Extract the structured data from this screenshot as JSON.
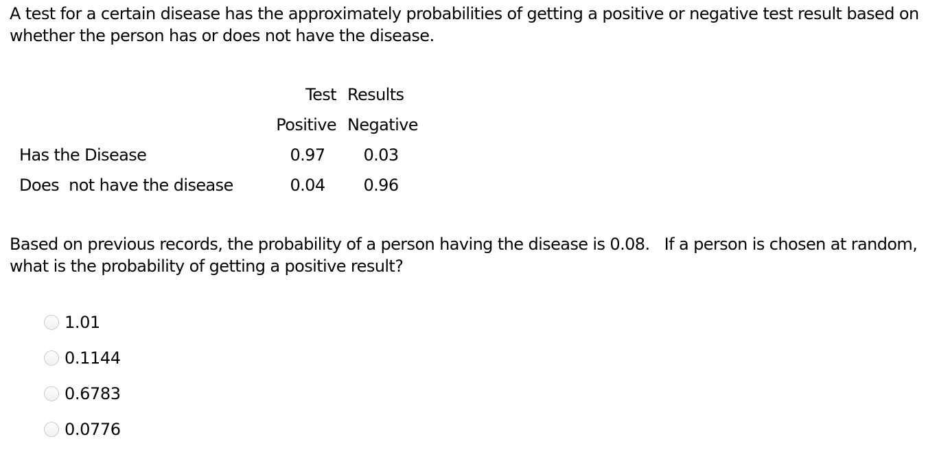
{
  "intro": "A test for a certain disease has the approximately probabilities of getting a positive or negative test result based on whether the person has or does not have the disease.",
  "table": {
    "header_row1": [
      "",
      "Test",
      "Results"
    ],
    "header_row2": [
      "",
      "Positive",
      "Negative"
    ],
    "rows": [
      {
        "label": "Has the Disease",
        "positive": "0.97",
        "negative": "0.03"
      },
      {
        "label": "Does  not have the disease",
        "positive": "0.04",
        "negative": "0.96"
      }
    ]
  },
  "question": "Based on previous records, the probability of a person having the disease is 0.08.   If a person is chosen at random, what is the probability of getting a positive result?",
  "options": [
    {
      "label": "1.01",
      "selected": false
    },
    {
      "label": "0.1144",
      "selected": false
    },
    {
      "label": "0.6783",
      "selected": false
    },
    {
      "label": "0.0776",
      "selected": false
    }
  ]
}
